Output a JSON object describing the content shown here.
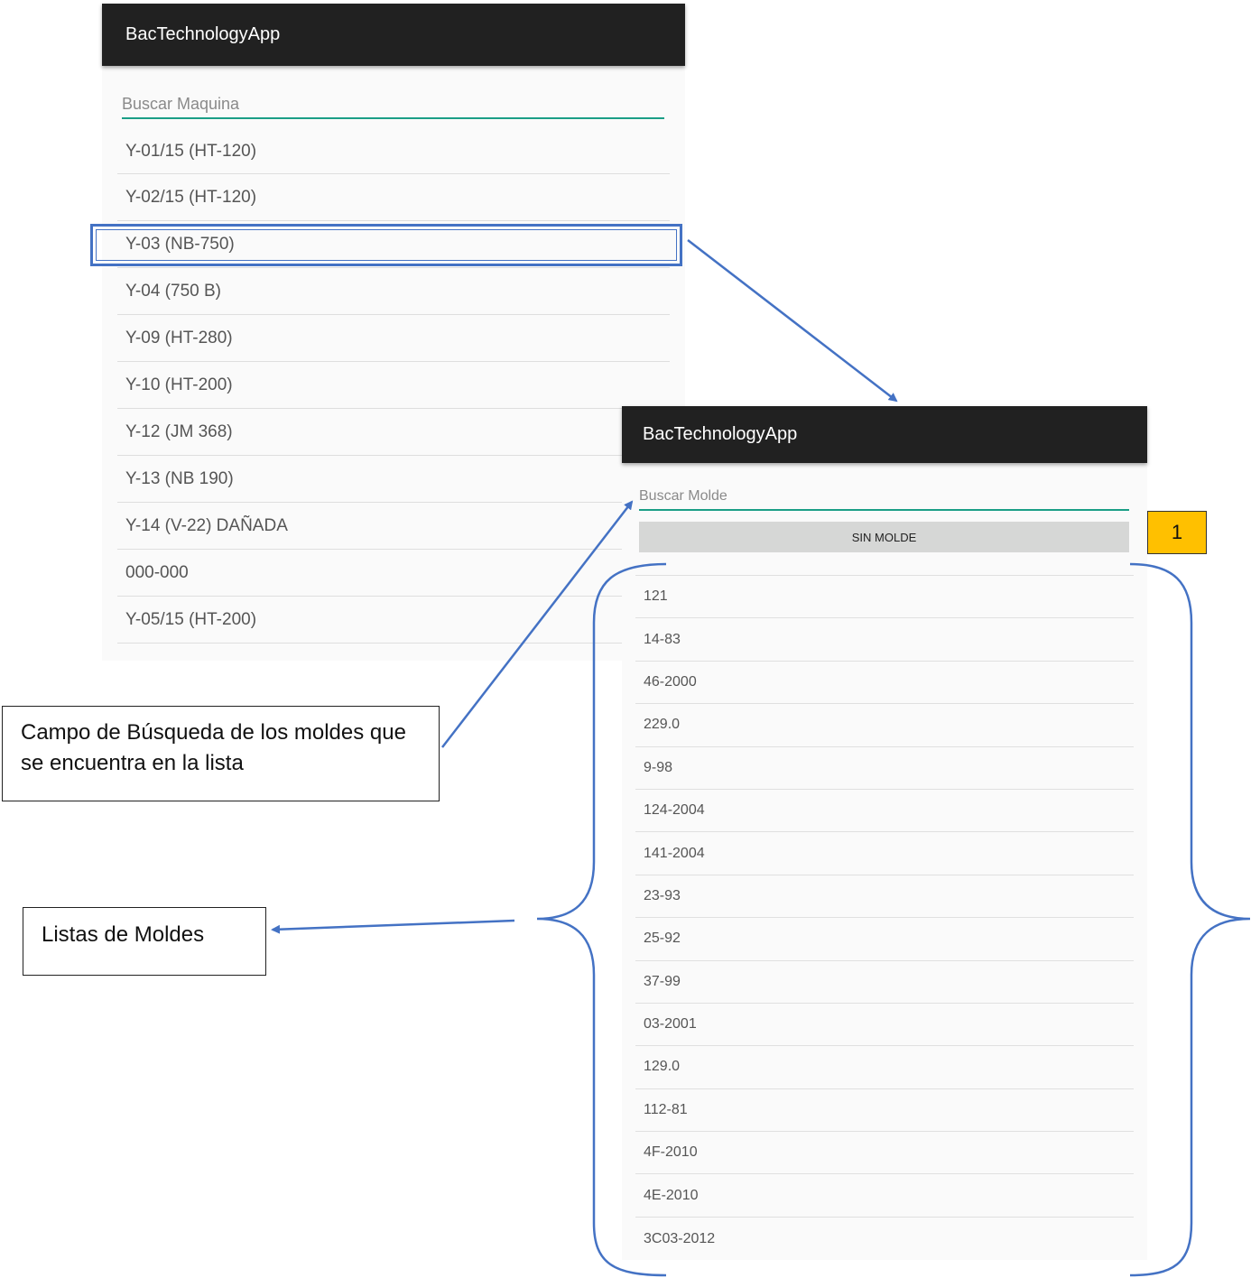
{
  "machine_screen": {
    "app_title": "BacTechnologyApp",
    "search_placeholder": "Buscar Maquina",
    "items": [
      "Y-01/15 (HT-120)",
      "Y-02/15 (HT-120)",
      "Y-03 (NB-750)",
      "Y-04 (750 B)",
      "Y-09  (HT-280)",
      "Y-10 (HT-200)",
      "Y-12 (JM 368)",
      "Y-13 (NB 190)",
      "Y-14 (V-22) DAÑADA",
      "000-000",
      "Y-05/15 (HT-200)"
    ],
    "selected_item": "Y-03 (NB-750)"
  },
  "mold_screen": {
    "app_title": "BacTechnologyApp",
    "search_placeholder": "Buscar Molde",
    "no_mold_button": "SIN MOLDE",
    "items": [
      "121",
      "14-83",
      "46-2000",
      "229.0",
      "9-98",
      "124-2004",
      "141-2004",
      "23-93",
      "25-92",
      "37-99",
      "03-2001",
      "129.0",
      "112-81",
      "4F-2010",
      "4E-2010",
      "3C03-2012"
    ]
  },
  "annotations": {
    "search_callout": "Campo de Búsqueda de los moldes que se encuentra en la lista",
    "list_callout": "Listas de Moldes",
    "badge_number": "1",
    "accent_color": "#4472c4",
    "badge_color": "#ffc000"
  }
}
